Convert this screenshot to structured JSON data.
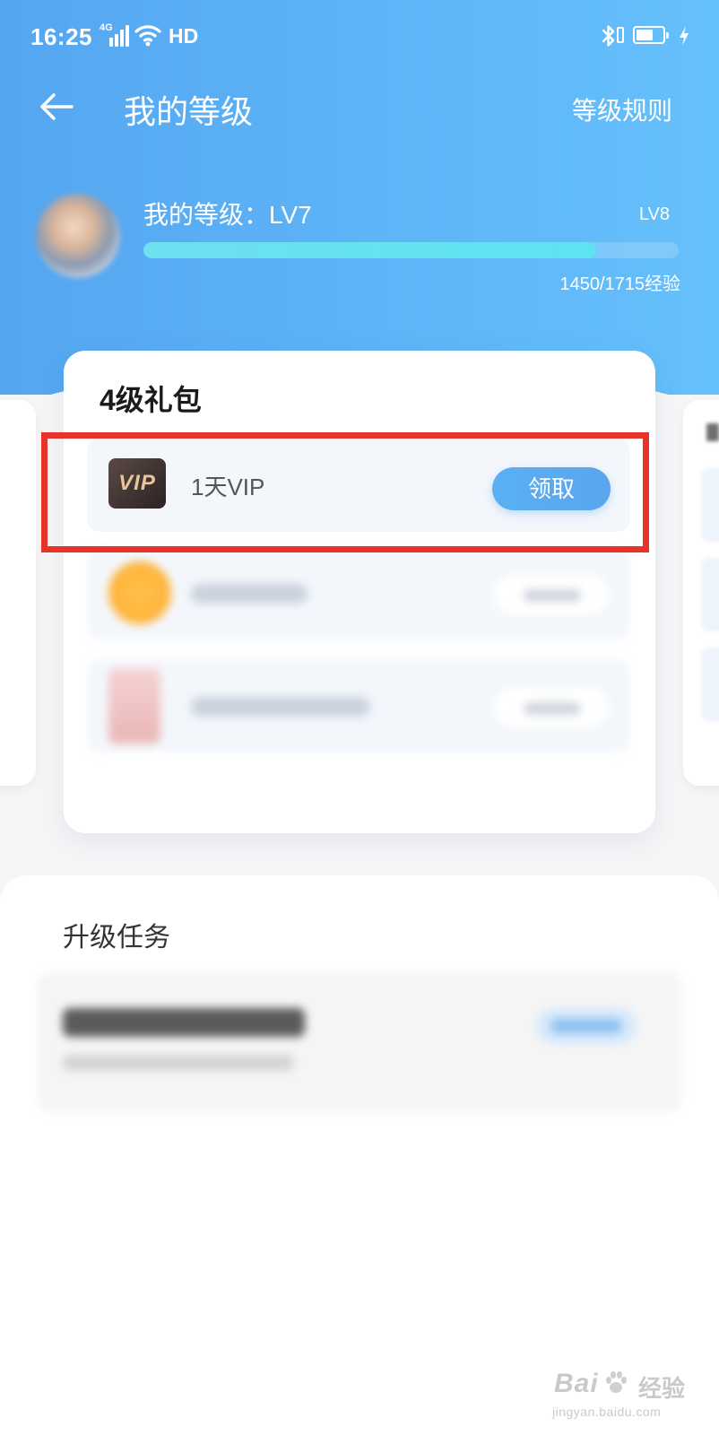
{
  "status_bar": {
    "time": "16:25",
    "network": "4G",
    "hd_label": "HD",
    "icons": [
      "signal-icon",
      "wifi-icon",
      "bluetooth-icon",
      "vibrate-icon",
      "battery-icon",
      "charging-icon"
    ]
  },
  "nav": {
    "back_icon": "back-arrow-icon",
    "title": "我的等级",
    "rules_link": "等级规则"
  },
  "profile": {
    "level_label": "我的等级：LV7",
    "next_level": "LV8",
    "experience": "1450/1715经验",
    "progress_current": 1450,
    "progress_max": 1715
  },
  "gift_card": {
    "title": "4级礼包",
    "items": [
      {
        "icon": "vip-badge-icon",
        "icon_text": "VIP",
        "name": "1天VIP",
        "button": "领取"
      },
      {
        "icon": "coin-icon",
        "blurred": true
      },
      {
        "icon": "book-icon",
        "blurred": true
      }
    ]
  },
  "tasks": {
    "title": "升级任务"
  },
  "watermark": {
    "brand": "Bai",
    "brand_cn": "经验",
    "url": "jingyan.baidu.com"
  },
  "colors": {
    "header_gradient_start": "#55a6f1",
    "header_gradient_end": "#66c0fb",
    "progress_fill": "#5ee3f0",
    "claim_button": "#5aabf1",
    "highlight_frame": "#e8332b",
    "page_background": "#f6f6f7"
  }
}
